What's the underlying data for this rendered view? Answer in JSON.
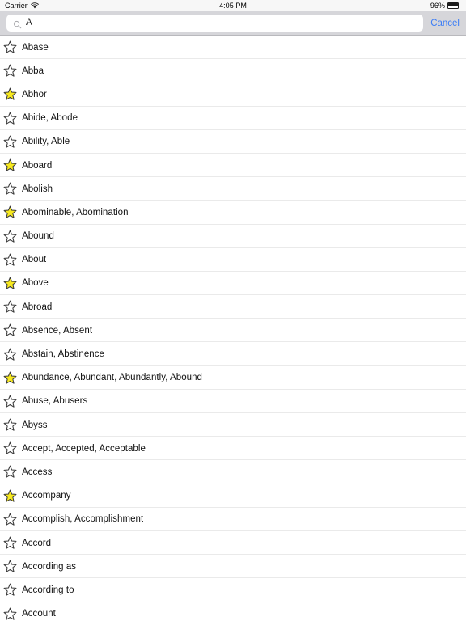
{
  "status_bar": {
    "carrier": "Carrier",
    "wifi_icon": "wifi-icon",
    "time": "4:05 PM",
    "battery_percent": "96%",
    "battery_icon": "battery-full-icon"
  },
  "search": {
    "icon": "search-icon",
    "value": "A",
    "placeholder": "Search",
    "cancel_label": "Cancel"
  },
  "colors": {
    "star_filled": "#f7e91e",
    "star_outline": "#3c3c3c",
    "accent_blue": "#3b7df6",
    "search_bar_bg": "#d6d6da",
    "separator": "#eaeaea",
    "status_bar_bg": "#f7f7f7"
  },
  "list": {
    "items": [
      {
        "label": "Abase",
        "starred": false
      },
      {
        "label": "Abba",
        "starred": false
      },
      {
        "label": "Abhor",
        "starred": true
      },
      {
        "label": "Abide, Abode",
        "starred": false
      },
      {
        "label": "Ability, Able",
        "starred": false
      },
      {
        "label": "Aboard",
        "starred": true
      },
      {
        "label": "Abolish",
        "starred": false
      },
      {
        "label": "Abominable, Abomination",
        "starred": true
      },
      {
        "label": "Abound",
        "starred": false
      },
      {
        "label": "About",
        "starred": false
      },
      {
        "label": "Above",
        "starred": true
      },
      {
        "label": "Abroad",
        "starred": false
      },
      {
        "label": "Absence, Absent",
        "starred": false
      },
      {
        "label": "Abstain, Abstinence",
        "starred": false
      },
      {
        "label": "Abundance, Abundant, Abundantly, Abound",
        "starred": true
      },
      {
        "label": "Abuse, Abusers",
        "starred": false
      },
      {
        "label": "Abyss",
        "starred": false
      },
      {
        "label": "Accept, Accepted, Acceptable",
        "starred": false
      },
      {
        "label": "Access",
        "starred": false
      },
      {
        "label": "Accompany",
        "starred": true
      },
      {
        "label": "Accomplish, Accomplishment",
        "starred": false
      },
      {
        "label": "Accord",
        "starred": false
      },
      {
        "label": "According as",
        "starred": false
      },
      {
        "label": "According to",
        "starred": false
      },
      {
        "label": "Account",
        "starred": false
      }
    ]
  }
}
